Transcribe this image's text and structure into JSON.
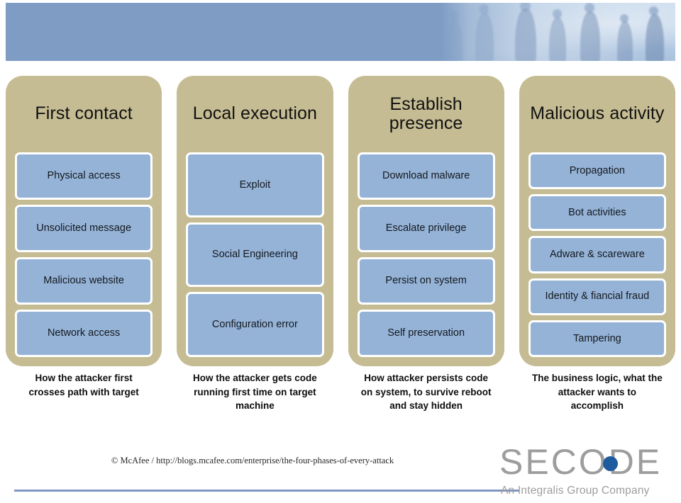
{
  "banner": {
    "alt": "blue header banner with faded photo of walking business people",
    "color": "#7e9cc4"
  },
  "colors": {
    "panel_tan": "#c5bc93",
    "item_blue": "#95b3d7",
    "banner_blue": "#7e9cc4",
    "rule_blue": "#7e96c0",
    "logo_gray": "#9d9d9d",
    "logo_dot_blue": "#1d5a9e"
  },
  "phases": [
    {
      "title": "First contact",
      "items": [
        "Physical access",
        "Unsolicited message",
        "Malicious website",
        "Network access"
      ],
      "caption": "How the attacker first crosses path with target"
    },
    {
      "title": "Local execution",
      "items": [
        "Exploit",
        "Social Engineering",
        "Configuration error"
      ],
      "caption": "How the attacker gets code running first time on target machine"
    },
    {
      "title": "Establish presence",
      "items": [
        "Download malware",
        "Escalate privilege",
        "Persist on system",
        "Self preservation"
      ],
      "caption": "How attacker persists code on system, to survive reboot and stay hidden"
    },
    {
      "title": "Malicious activity",
      "items": [
        "Propagation",
        "Bot activities",
        "Adware & scareware",
        "Identity & fiancial fraud",
        "Tampering"
      ],
      "caption": "The business logic, what the attacker wants to accomplish"
    }
  ],
  "footer": {
    "attribution": "© McAfee / http://blogs.mcafee.com/enterprise/the-four-phases-of-every-attack",
    "logo_word": "SECODE",
    "logo_tagline": "An Integralis Group Company"
  }
}
